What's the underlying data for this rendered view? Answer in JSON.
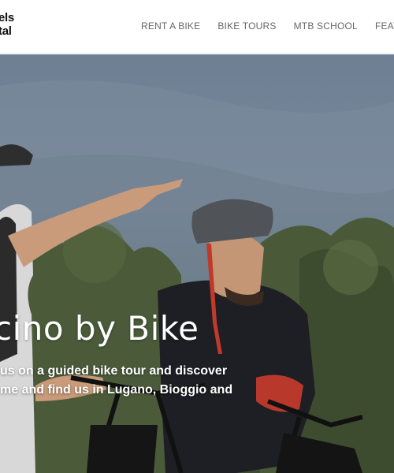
{
  "header": {
    "logo_line1": "els",
    "logo_line2": "tal",
    "nav": [
      {
        "label": "RENT A BIKE"
      },
      {
        "label": "BIKE TOURS"
      },
      {
        "label": "MTB SCHOOL"
      },
      {
        "label": "FEATUR"
      }
    ]
  },
  "hero": {
    "title": "cino by Bike",
    "description_line1": "us on a guided bike tour and discover",
    "description_line2": "me and find us in Lugano, Bioggio and"
  }
}
